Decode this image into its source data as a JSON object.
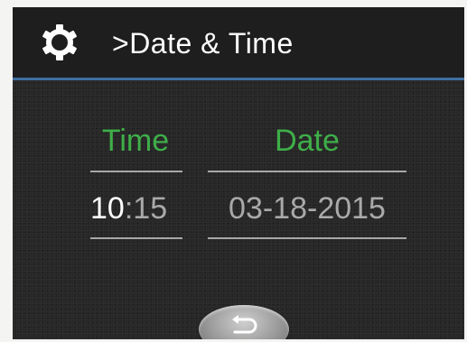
{
  "header": {
    "icon": "gear-icon",
    "title": ">Date & Time",
    "accent_line_color": "#3f6fa0"
  },
  "columns": {
    "time_label": "Time",
    "date_label": "Date",
    "label_color": "#3fae49"
  },
  "values": {
    "hours": "10",
    "separator": ":",
    "minutes": "15",
    "date": "03-18-2015"
  },
  "footer": {
    "back_icon": "return-arrow-icon"
  }
}
